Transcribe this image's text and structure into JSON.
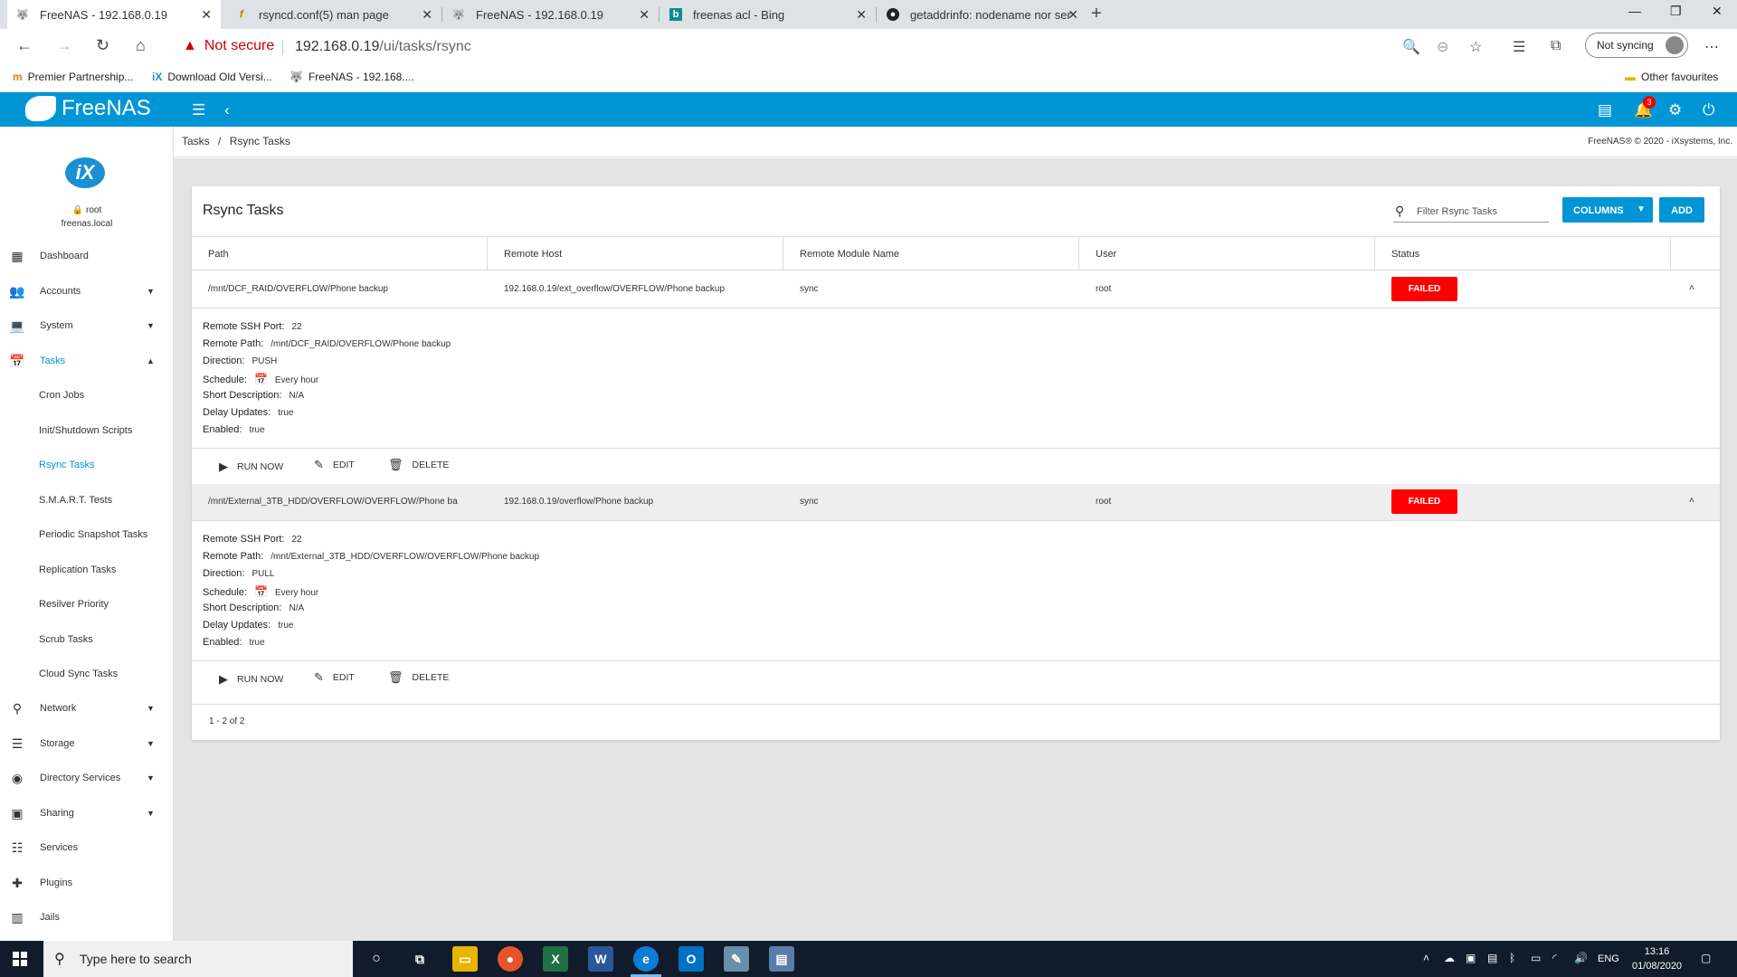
{
  "browser": {
    "tabs": [
      {
        "label": "FreeNAS - 192.168.0.19",
        "icon": "freenas-icon"
      },
      {
        "label": "rsyncd.conf(5) man page",
        "icon": "pen-icon"
      },
      {
        "label": "FreeNAS - 192.168.0.19",
        "icon": "freenas-icon"
      },
      {
        "label": "freenas acl - Bing",
        "icon": "bing-icon"
      },
      {
        "label": "getaddrinfo: nodename nor serv",
        "icon": "github-icon"
      }
    ],
    "security_label": "Not secure",
    "url_host": "192.168.0.19",
    "url_path": "/ui/tasks/rsync",
    "sync_label": "Not syncing",
    "favourites": [
      "Premier Partnership...",
      "Download Old Versi...",
      "FreeNAS - 192.168...."
    ],
    "other_favourites": "Other favourites"
  },
  "app": {
    "brand": "FreeNAS",
    "notification_count": "3",
    "user": "root",
    "hostname": "freenas.local",
    "breadcrumb": {
      "parent": "Tasks",
      "separator": "/",
      "current": "Rsync Tasks"
    },
    "copyright": "FreeNAS® © 2020 - iXsystems, Inc."
  },
  "sidebar": {
    "items": [
      {
        "label": "Dashboard",
        "icon": "dashboard-icon"
      },
      {
        "label": "Accounts",
        "icon": "accounts-icon"
      },
      {
        "label": "System",
        "icon": "laptop-icon"
      },
      {
        "label": "Tasks",
        "icon": "calendar-icon"
      },
      {
        "label": "Cron Jobs"
      },
      {
        "label": "Init/Shutdown Scripts"
      },
      {
        "label": "Rsync Tasks"
      },
      {
        "label": "S.M.A.R.T. Tests"
      },
      {
        "label": "Periodic Snapshot Tasks"
      },
      {
        "label": "Replication Tasks"
      },
      {
        "label": "Resilver Priority"
      },
      {
        "label": "Scrub Tasks"
      },
      {
        "label": "Cloud Sync Tasks"
      },
      {
        "label": "Network",
        "icon": "network-icon"
      },
      {
        "label": "Storage",
        "icon": "storage-icon"
      },
      {
        "label": "Directory Services",
        "icon": "directory-icon"
      },
      {
        "label": "Sharing",
        "icon": "sharing-icon"
      },
      {
        "label": "Services",
        "icon": "services-icon"
      },
      {
        "label": "Plugins",
        "icon": "plugin-icon"
      },
      {
        "label": "Jails",
        "icon": "jail-icon"
      }
    ]
  },
  "card": {
    "title": "Rsync Tasks",
    "filter_placeholder": "Filter Rsync Tasks",
    "columns_button": "COLUMNS",
    "add_button": "ADD",
    "headers": [
      "Path",
      "Remote Host",
      "Remote Module Name",
      "User",
      "Status"
    ],
    "detail_labels": {
      "port": "Remote SSH Port:",
      "path": "Remote Path:",
      "direction": "Direction:",
      "schedule": "Schedule:",
      "desc": "Short Description:",
      "delay": "Delay Updates:",
      "enabled": "Enabled:"
    },
    "actions": {
      "run": "RUN NOW",
      "edit": "EDIT",
      "delete": "DELETE"
    },
    "rows": [
      {
        "path": "/mnt/DCF_RAID/OVERFLOW/Phone backup",
        "remote_host": "192.168.0.19/ext_overflow/OVERFLOW/Phone backup",
        "module": "sync",
        "user": "root",
        "status": "FAILED",
        "ssh_port": "22",
        "remote_path": "/mnt/DCF_RAID/OVERFLOW/Phone backup",
        "direction": "PUSH",
        "schedule": "Every hour",
        "description": "N/A",
        "delay_updates": "true",
        "enabled": "true"
      },
      {
        "path": "/mnt/External_3TB_HDD/OVERFLOW/OVERFLOW/Phone ba",
        "remote_host": "192.168.0.19/overflow/Phone backup",
        "module": "sync",
        "user": "root",
        "status": "FAILED",
        "ssh_port": "22",
        "remote_path": "/mnt/External_3TB_HDD/OVERFLOW/OVERFLOW/Phone backup",
        "direction": "PULL",
        "schedule": "Every hour",
        "description": "N/A",
        "delay_updates": "true",
        "enabled": "true"
      }
    ],
    "pager": "1 - 2 of 2"
  },
  "taskbar": {
    "search_placeholder": "Type here to search",
    "language": "ENG",
    "time": "13:16",
    "date": "01/08/2020"
  },
  "colors": {
    "brand": "#0095d5",
    "failed": "#ff0000",
    "taskbar": "#101b2b"
  }
}
